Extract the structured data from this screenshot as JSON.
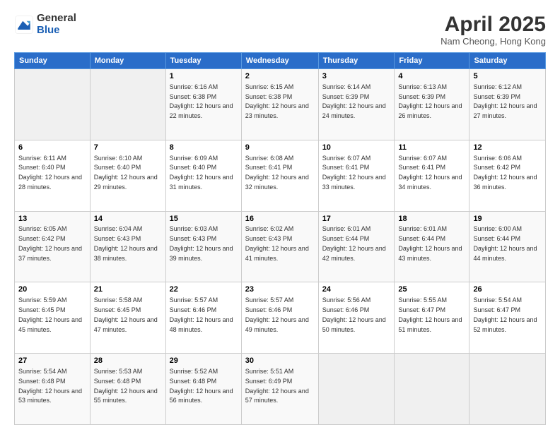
{
  "header": {
    "logo_line1": "General",
    "logo_line2": "Blue",
    "month": "April 2025",
    "location": "Nam Cheong, Hong Kong"
  },
  "weekdays": [
    "Sunday",
    "Monday",
    "Tuesday",
    "Wednesday",
    "Thursday",
    "Friday",
    "Saturday"
  ],
  "weeks": [
    [
      null,
      null,
      {
        "day": 1,
        "sunrise": "6:16 AM",
        "sunset": "6:38 PM",
        "daylight": "12 hours and 22 minutes."
      },
      {
        "day": 2,
        "sunrise": "6:15 AM",
        "sunset": "6:38 PM",
        "daylight": "12 hours and 23 minutes."
      },
      {
        "day": 3,
        "sunrise": "6:14 AM",
        "sunset": "6:39 PM",
        "daylight": "12 hours and 24 minutes."
      },
      {
        "day": 4,
        "sunrise": "6:13 AM",
        "sunset": "6:39 PM",
        "daylight": "12 hours and 26 minutes."
      },
      {
        "day": 5,
        "sunrise": "6:12 AM",
        "sunset": "6:39 PM",
        "daylight": "12 hours and 27 minutes."
      }
    ],
    [
      {
        "day": 6,
        "sunrise": "6:11 AM",
        "sunset": "6:40 PM",
        "daylight": "12 hours and 28 minutes."
      },
      {
        "day": 7,
        "sunrise": "6:10 AM",
        "sunset": "6:40 PM",
        "daylight": "12 hours and 29 minutes."
      },
      {
        "day": 8,
        "sunrise": "6:09 AM",
        "sunset": "6:40 PM",
        "daylight": "12 hours and 31 minutes."
      },
      {
        "day": 9,
        "sunrise": "6:08 AM",
        "sunset": "6:41 PM",
        "daylight": "12 hours and 32 minutes."
      },
      {
        "day": 10,
        "sunrise": "6:07 AM",
        "sunset": "6:41 PM",
        "daylight": "12 hours and 33 minutes."
      },
      {
        "day": 11,
        "sunrise": "6:07 AM",
        "sunset": "6:41 PM",
        "daylight": "12 hours and 34 minutes."
      },
      {
        "day": 12,
        "sunrise": "6:06 AM",
        "sunset": "6:42 PM",
        "daylight": "12 hours and 36 minutes."
      }
    ],
    [
      {
        "day": 13,
        "sunrise": "6:05 AM",
        "sunset": "6:42 PM",
        "daylight": "12 hours and 37 minutes."
      },
      {
        "day": 14,
        "sunrise": "6:04 AM",
        "sunset": "6:43 PM",
        "daylight": "12 hours and 38 minutes."
      },
      {
        "day": 15,
        "sunrise": "6:03 AM",
        "sunset": "6:43 PM",
        "daylight": "12 hours and 39 minutes."
      },
      {
        "day": 16,
        "sunrise": "6:02 AM",
        "sunset": "6:43 PM",
        "daylight": "12 hours and 41 minutes."
      },
      {
        "day": 17,
        "sunrise": "6:01 AM",
        "sunset": "6:44 PM",
        "daylight": "12 hours and 42 minutes."
      },
      {
        "day": 18,
        "sunrise": "6:01 AM",
        "sunset": "6:44 PM",
        "daylight": "12 hours and 43 minutes."
      },
      {
        "day": 19,
        "sunrise": "6:00 AM",
        "sunset": "6:44 PM",
        "daylight": "12 hours and 44 minutes."
      }
    ],
    [
      {
        "day": 20,
        "sunrise": "5:59 AM",
        "sunset": "6:45 PM",
        "daylight": "12 hours and 45 minutes."
      },
      {
        "day": 21,
        "sunrise": "5:58 AM",
        "sunset": "6:45 PM",
        "daylight": "12 hours and 47 minutes."
      },
      {
        "day": 22,
        "sunrise": "5:57 AM",
        "sunset": "6:46 PM",
        "daylight": "12 hours and 48 minutes."
      },
      {
        "day": 23,
        "sunrise": "5:57 AM",
        "sunset": "6:46 PM",
        "daylight": "12 hours and 49 minutes."
      },
      {
        "day": 24,
        "sunrise": "5:56 AM",
        "sunset": "6:46 PM",
        "daylight": "12 hours and 50 minutes."
      },
      {
        "day": 25,
        "sunrise": "5:55 AM",
        "sunset": "6:47 PM",
        "daylight": "12 hours and 51 minutes."
      },
      {
        "day": 26,
        "sunrise": "5:54 AM",
        "sunset": "6:47 PM",
        "daylight": "12 hours and 52 minutes."
      }
    ],
    [
      {
        "day": 27,
        "sunrise": "5:54 AM",
        "sunset": "6:48 PM",
        "daylight": "12 hours and 53 minutes."
      },
      {
        "day": 28,
        "sunrise": "5:53 AM",
        "sunset": "6:48 PM",
        "daylight": "12 hours and 55 minutes."
      },
      {
        "day": 29,
        "sunrise": "5:52 AM",
        "sunset": "6:48 PM",
        "daylight": "12 hours and 56 minutes."
      },
      {
        "day": 30,
        "sunrise": "5:51 AM",
        "sunset": "6:49 PM",
        "daylight": "12 hours and 57 minutes."
      },
      null,
      null,
      null
    ]
  ]
}
